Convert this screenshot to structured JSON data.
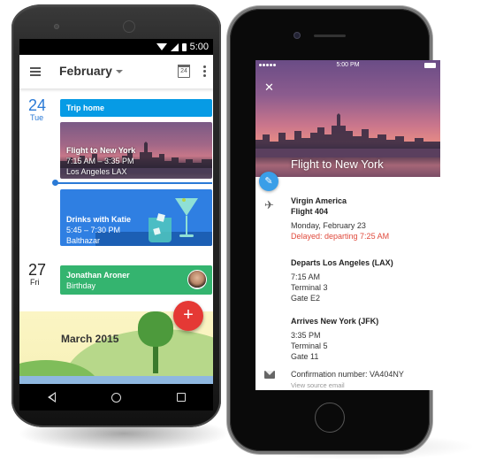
{
  "android": {
    "status_bar": {
      "time": "5:00"
    },
    "toolbar": {
      "title": "February",
      "calendar_icon_day": "24"
    },
    "days": [
      {
        "number": "24",
        "name": "Tue"
      },
      {
        "number": "27",
        "name": "Fri"
      }
    ],
    "events": {
      "trip": {
        "title": "Trip home"
      },
      "flight": {
        "title": "Flight to New York",
        "time": "7:15 AM – 3:35 PM",
        "location": "Los Angeles LAX"
      },
      "drinks": {
        "title": "Drinks with Katie",
        "time": "5:45 – 7:30 PM",
        "location": "Balthazar"
      },
      "birthday": {
        "title": "Jonathan Aroner",
        "subtitle": "Birthday"
      }
    },
    "month_banner": "March 2015",
    "fab_label": "+",
    "colors": {
      "trip": "#069be5",
      "drinks": "#2f7fe2",
      "birthday": "#34b46f",
      "fab": "#e53935",
      "today": "#2a7ad6"
    }
  },
  "iphone": {
    "status_bar": {
      "time": "5:00 PM"
    },
    "close_label": "✕",
    "hero_title": "Flight to New York",
    "edit_icon": "✎",
    "flight": {
      "airline": "Virgin America",
      "number": "Flight 404",
      "date": "Monday, February 23",
      "status": "Delayed: departing 7:25 AM"
    },
    "departs": {
      "heading": "Departs Los Angeles (LAX)",
      "time": "7:15 AM",
      "terminal": "Terminal 3",
      "gate": "Gate E2"
    },
    "arrives": {
      "heading": "Arrives New York (JFK)",
      "time": "3:35 PM",
      "terminal": "Terminal 5",
      "gate": "Gate 11"
    },
    "confirmation": "Confirmation number: VA404NY",
    "view_source": "View source email",
    "colors": {
      "delay": "#e04a3c",
      "edit_fab": "#3a9ee8"
    }
  }
}
